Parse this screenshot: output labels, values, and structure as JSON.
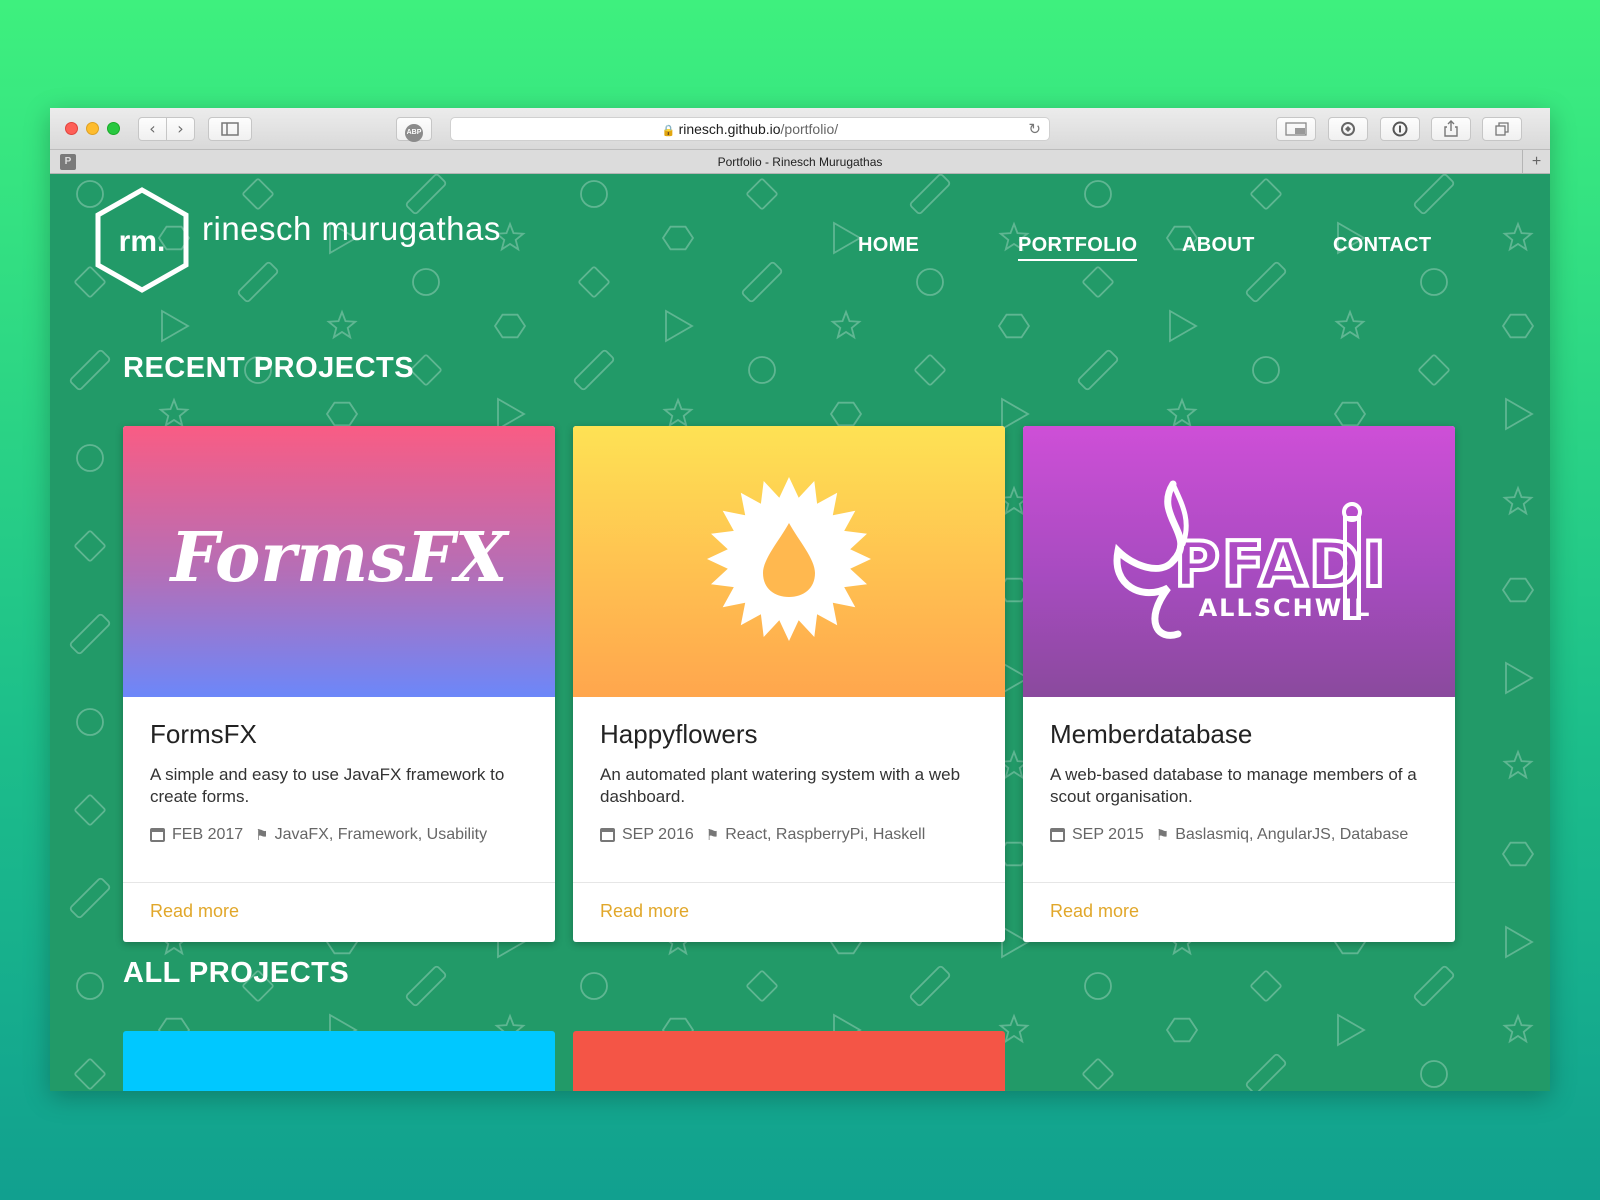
{
  "browser": {
    "url_host": "rinesch.github.io",
    "url_path": "/portfolio/",
    "tab_title": "Portfolio - Rinesch Murugathas",
    "tab_favicon_letter": "P",
    "abp_label": "ABP",
    "buttons": {
      "back": "‹",
      "forward": "›",
      "reload": "↻",
      "new_tab": "+",
      "sidebar_icon": "sidebar-icon",
      "right_icons": [
        "reader-icon",
        "sync-icon",
        "info-icon",
        "share-icon",
        "tabs-icon"
      ]
    }
  },
  "site": {
    "logo_mark": "rm.",
    "logo_name": "rinesch murugathas",
    "nav": [
      {
        "label": "HOME",
        "active": false
      },
      {
        "label": "PORTFOLIO",
        "active": true
      },
      {
        "label": "ABOUT",
        "active": false
      },
      {
        "label": "CONTACT",
        "active": false
      }
    ]
  },
  "sections": {
    "recent": "RECENT PROJECTS",
    "all": "ALL PROJECTS"
  },
  "projects": [
    {
      "title": "FormsFX",
      "logo_text": "FormsFX",
      "description": "A simple and easy to use JavaFX framework to create forms.",
      "date": "FEB 2017",
      "tags": "JavaFX, Framework, Usability",
      "read_more": "Read more"
    },
    {
      "title": "Happyflowers",
      "description": "An automated plant watering system with a web dashboard.",
      "date": "SEP 2016",
      "tags": "React, RaspberryPi, Haskell",
      "read_more": "Read more"
    },
    {
      "title": "Memberdatabase",
      "logo_text": "PFADI",
      "logo_subtext": "ALLSCHWIL",
      "description": "A web-based database to manage members of a scout organisation.",
      "date": "SEP 2015",
      "tags": "Baslasmiq, AngularJS, Database",
      "read_more": "Read more"
    }
  ],
  "colors": {
    "page_bg": "#229a68",
    "accent_link": "#e1a72a",
    "all_projects_card1": "#00c8ff",
    "all_projects_card2": "#f45546"
  }
}
